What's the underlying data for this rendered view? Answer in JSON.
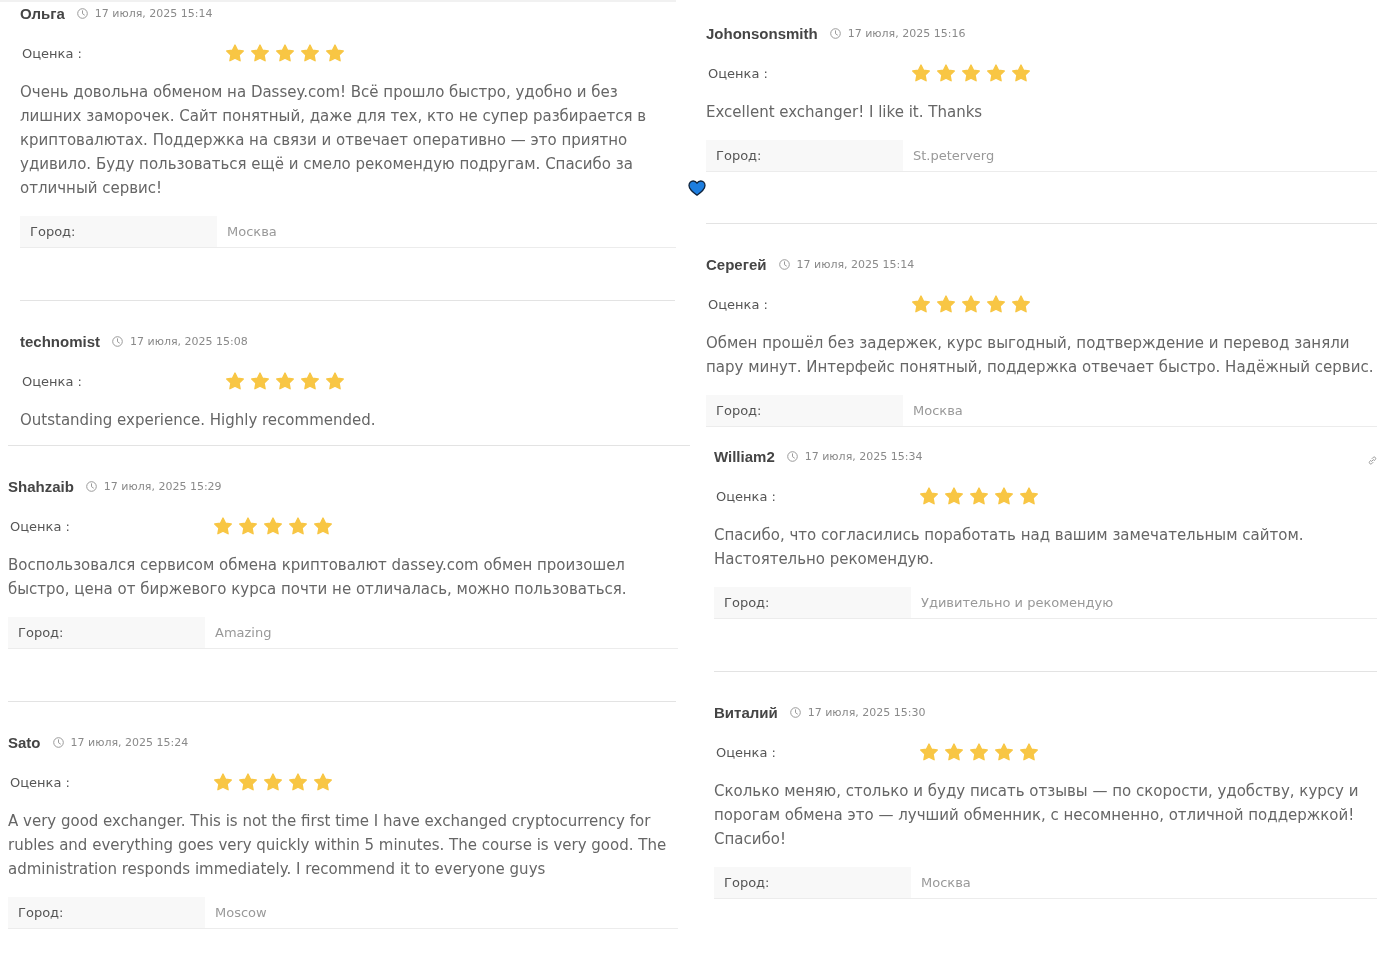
{
  "columns": [
    {
      "reviews": [
        {
          "author": "Ольга",
          "date": "17 июля, 2025 15:14",
          "rating_label": "Оценка :",
          "stars": 5,
          "text": "Очень довольна обменом на Dassey.com! Всё прошло быстро, удобно и без лишних заморочек. Сайт понятный, даже для тех, кто не супер разбирается в криптовалютах. Поддержка на связи и отвечает оперативно — это приятно удивило. Буду пользоваться ещё и смело рекомендую подругам. Спасибо за отличный сервис!",
          "heart_emoji": true,
          "city_label": "Город:",
          "city": "Москва"
        },
        {
          "author": "technomist",
          "date": "17 июля, 2025 15:08",
          "rating_label": "Оценка :",
          "stars": 5,
          "text": "Outstanding experience. Highly recommended."
        },
        {
          "author": "Shahzaib",
          "date": "17 июля, 2025 15:29",
          "rating_label": "Оценка :",
          "stars": 5,
          "text": "Воспользовался сервисом обмена криптовалют dassey.com обмен произошел быстро, цена от биржевого курса почти не отличалась, можно пользоваться.",
          "city_label": "Город:",
          "city": "Amazing"
        },
        {
          "author": "Sato",
          "date": "17 июля, 2025 15:24",
          "rating_label": "Оценка :",
          "stars": 5,
          "text": "A very good exchanger. This is not the first time I have exchanged cryptocurrency for rubles and everything goes very quickly within 5 minutes. The course is very good. The administration responds immediately. I recommend it to everyone guys",
          "city_label": "Город:",
          "city": "Moscow"
        }
      ]
    },
    {
      "reviews": [
        {
          "author": "Johonsonsmith",
          "date": "17 июля, 2025 15:16",
          "rating_label": "Оценка :",
          "stars": 5,
          "text": "Excellent exchanger! I like it. Thanks",
          "city_label": "Город:",
          "city": "St.peterverg"
        },
        {
          "author": "Серегей",
          "date": "17 июля, 2025 15:14",
          "rating_label": "Оценка :",
          "stars": 5,
          "text": "Обмен прошёл без задержек, курс выгодный, подтверждение и перевод заняли пару минут. Интерфейс понятный, поддержка отвечает быстро. Надёжный сервис.",
          "city_label": "Город:",
          "city": "Москва"
        },
        {
          "author": "William2",
          "date": "17 июля, 2025 15:34",
          "rating_label": "Оценка :",
          "stars": 5,
          "text": "Спасибо, что согласились поработать над вашим замечательным сайтом. Настоятельно рекомендую.",
          "city_label": "Город:",
          "city": "Удивительно и рекомендую",
          "link_icon": true
        },
        {
          "author": "Виталий",
          "date": "17 июля, 2025 15:30",
          "rating_label": "Оценка :",
          "stars": 5,
          "text": "Сколько меняю, столько и буду писать отзывы — по скорости, удобству, курсу и порогам обмена это — лучший обменник, с несомненно, отличной поддержкой! Спасибо!",
          "city_label": "Город:",
          "city": "Москва"
        }
      ]
    }
  ]
}
